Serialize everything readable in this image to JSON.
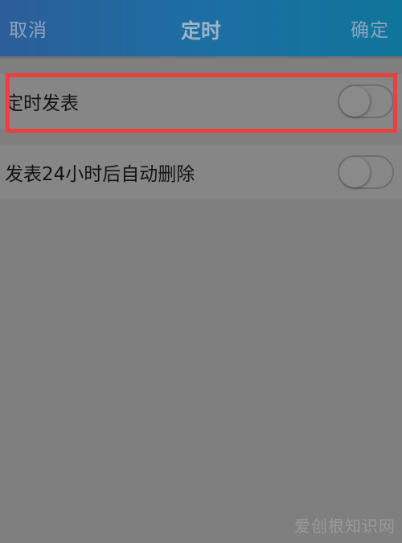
{
  "header": {
    "cancel_label": "取消",
    "title": "定时",
    "confirm_label": "确定"
  },
  "settings": {
    "items": [
      {
        "label": "定时发表",
        "enabled": false
      },
      {
        "label": "发表24小时后自动删除",
        "enabled": false
      }
    ]
  },
  "annotation": {
    "highlight_color": "#e8413e"
  },
  "watermark": {
    "text": "爱创根知识网"
  }
}
